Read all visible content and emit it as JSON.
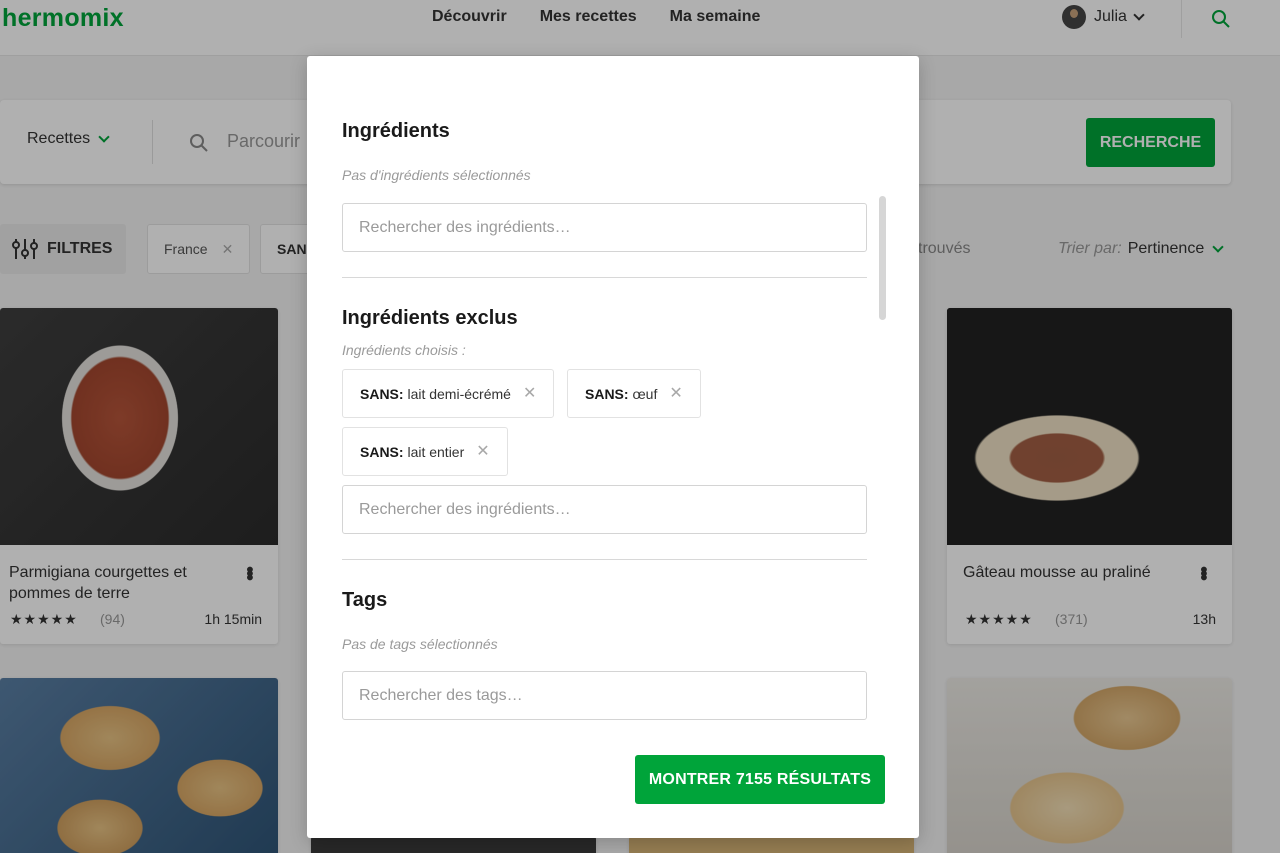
{
  "header": {
    "logo": "hermomix",
    "nav": [
      "Découvrir",
      "Mes recettes",
      "Ma semaine"
    ],
    "user_name": "Julia"
  },
  "search": {
    "type_label": "Recettes",
    "placeholder": "Parcourir",
    "button_label": "RECHERCHE"
  },
  "filter_bar": {
    "filters_label": "FILTRES",
    "chip_country": "France",
    "chip_sans": "SAN",
    "found_text": "trouvés",
    "sort_prefix": "Trier par:",
    "sort_value": "Pertinence"
  },
  "cards": [
    {
      "title": "Parmigiana courgettes et pommes de terre",
      "rating_stars": "★★★★★",
      "rating": 4.5,
      "reviews": "(94)",
      "time": "1h 15min"
    },
    {
      "title": "Gâteau mousse au praliné",
      "rating_stars": "★★★★★",
      "rating": 4.5,
      "reviews": "(371)",
      "time": "13h"
    }
  ],
  "modal": {
    "ingredients": {
      "heading": "Ingrédients",
      "note": "Pas d'ingrédients sélectionnés",
      "placeholder": "Rechercher des ingrédients…"
    },
    "excluded": {
      "heading": "Ingrédients exclus",
      "note": "Ingrédients choisis :",
      "tags": [
        {
          "prefix": "SANS:",
          "label": "lait demi-écrémé"
        },
        {
          "prefix": "SANS:",
          "label": "œuf"
        },
        {
          "prefix": "SANS:",
          "label": "lait entier"
        }
      ],
      "placeholder": "Rechercher des ingrédients…"
    },
    "tags": {
      "heading": "Tags",
      "note": "Pas de tags sélectionnés",
      "placeholder": "Rechercher des tags…"
    },
    "submit_label": "MONTRER 7155 RÉSULTATS"
  },
  "colors": {
    "brand_green": "#00a43a",
    "overlay": "#000000"
  }
}
